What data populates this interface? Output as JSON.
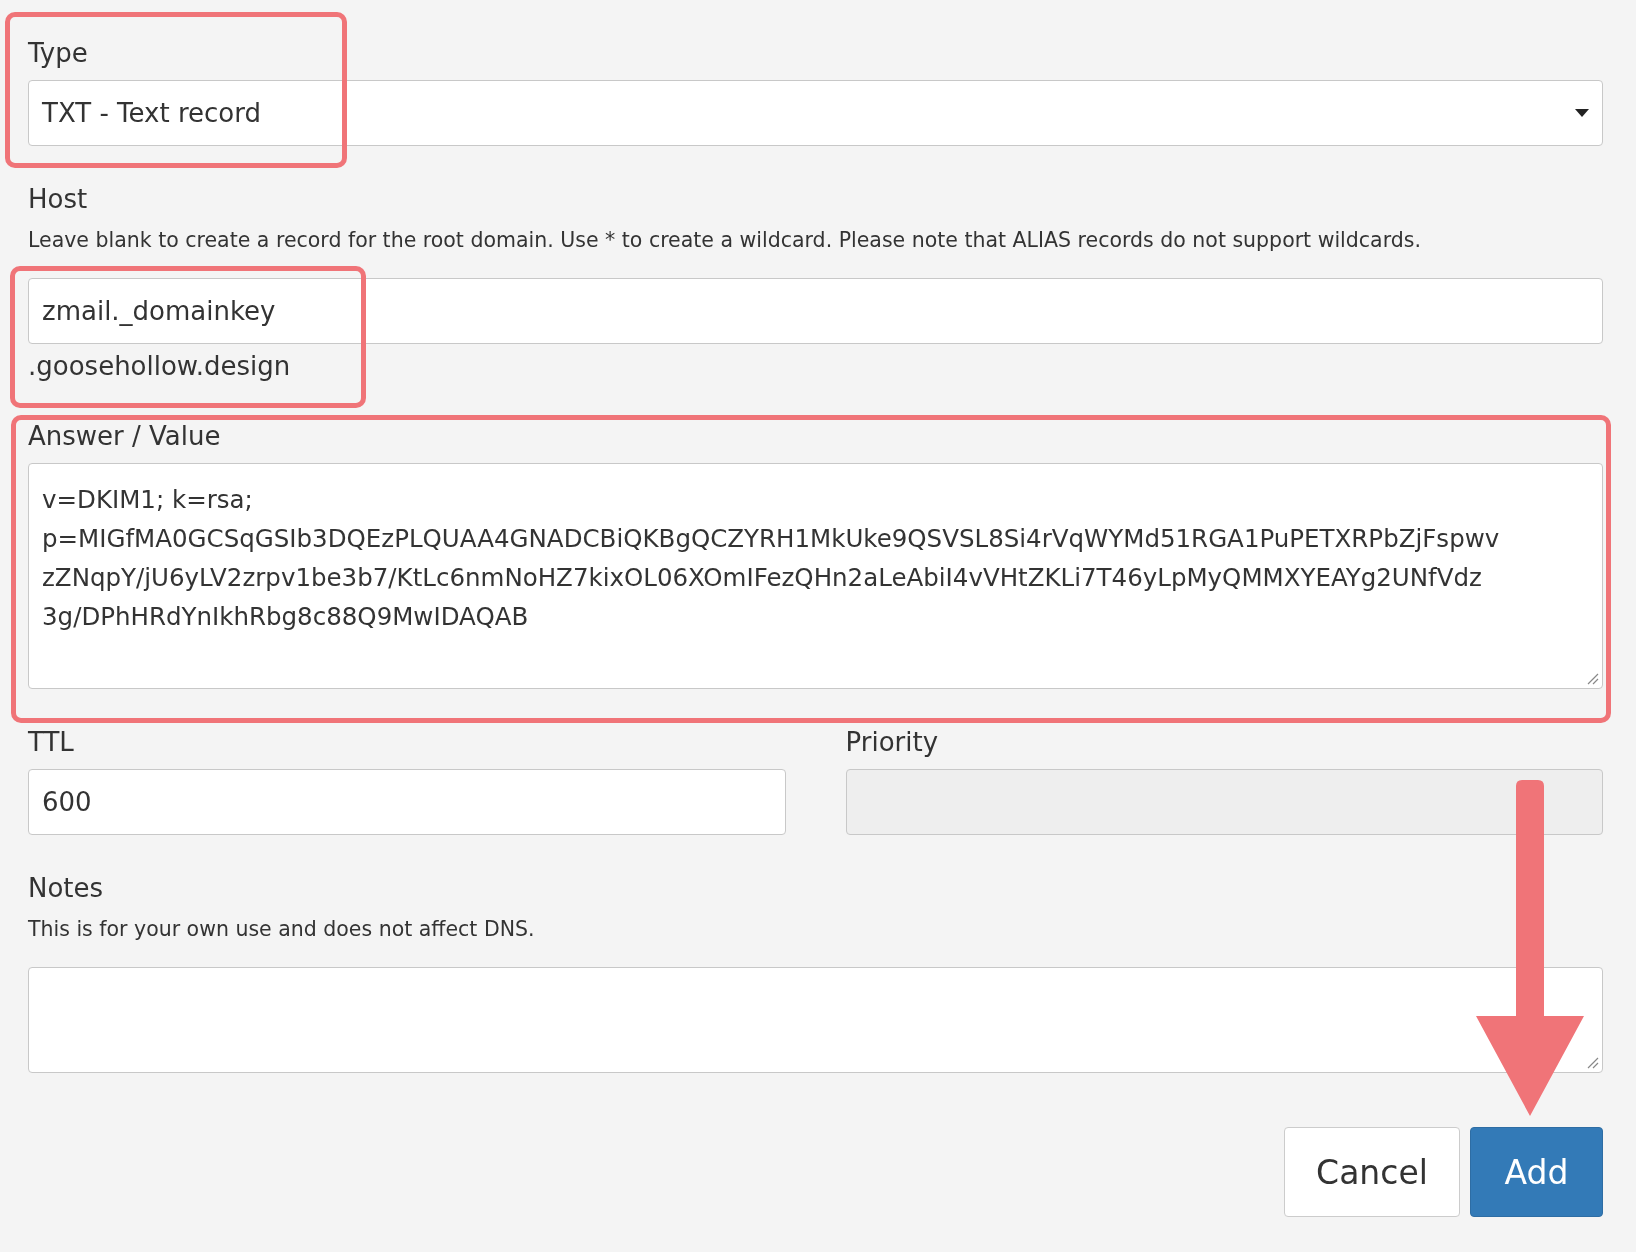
{
  "type_field": {
    "label": "Type",
    "value": "TXT - Text record"
  },
  "host_field": {
    "label": "Host",
    "hint": "Leave blank to create a record for the root domain. Use * to create a wildcard. Please note that ALIAS records do not support wildcards.",
    "value": "zmail._domainkey",
    "suffix": ".goosehollow.design"
  },
  "answer_field": {
    "label": "Answer / Value",
    "value_lines": [
      "v=DKIM1; k=rsa;",
      "p=MIGfMA0GCSqGSIb3DQEzPLQUAA4GNADCBiQKBgQCZYRH1MkUke9QSVSL8Si4rVqWYMd51RGA1PuPETXRPbZjFspwv",
      "zZNqpY/jU6yLV2zrpv1be3b7/KtLc6nmNoHZ7kixOL06XOmIFezQHn2aLeAbiI4vVHtZKLi7T46yLpMyQMMXYEAYg2UNfVdz",
      "3g/DPhHRdYnIkhRbg8c88Q9MwIDAQAB"
    ]
  },
  "ttl_field": {
    "label": "TTL",
    "value": "600",
    "disabled": false
  },
  "priority_field": {
    "label": "Priority",
    "disabled": true
  },
  "notes_field": {
    "label": "Notes",
    "hint": "This is for your own use and does not affect DNS."
  },
  "buttons": [
    {
      "label": "Cancel",
      "kind": "secondary"
    },
    {
      "label": "Add",
      "kind": "primary"
    }
  ]
}
